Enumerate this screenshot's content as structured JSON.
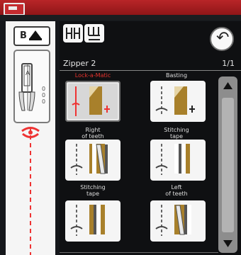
{
  "left": {
    "needle_letter": "B",
    "foot_numbers": [
      "0",
      "0",
      "0"
    ]
  },
  "header": {
    "title": "Zipper 2",
    "page": "1/1"
  },
  "stitches": [
    {
      "label": "Lock-a-Matic",
      "active": true
    },
    {
      "label": "Basting",
      "active": false
    },
    {
      "label": "Right\nof teeth",
      "active": false
    },
    {
      "label": "Stitching\ntape",
      "active": false
    },
    {
      "label": "Stitching\ntape",
      "active": false
    },
    {
      "label": "Left\nof teeth",
      "active": false
    }
  ],
  "colors": {
    "accent_red": "#e6312c",
    "panel_bg": "#f5f5f5",
    "scroll": "#8d8d8d"
  },
  "icons": [
    "needle-position-icon",
    "presser-foot-icon",
    "stitch-width-icon",
    "stitch-length-icon",
    "back-arrow-icon",
    "scroll-up-icon",
    "scroll-down-icon"
  ]
}
